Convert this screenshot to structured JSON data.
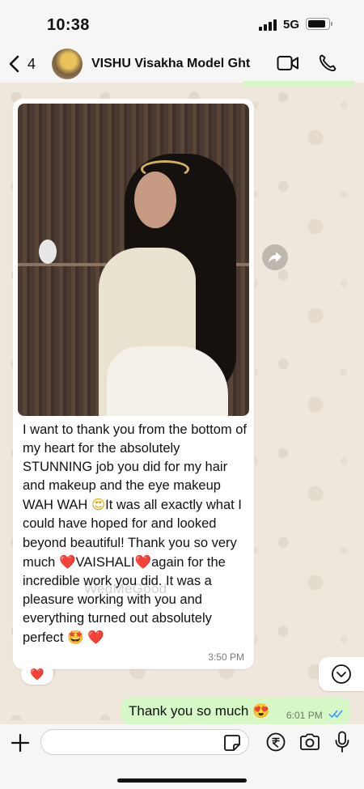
{
  "status_bar": {
    "time": "10:38",
    "network": "5G"
  },
  "header": {
    "back_count": "4",
    "contact_name": "VISHU Visakha Model Ght",
    "icons": [
      "chevron-left-icon",
      "video-call-icon",
      "phone-call-icon"
    ]
  },
  "incoming_message": {
    "text_parts": [
      "I want to thank you from the bottom of my heart for the absolutely STUNNING job you did for my hair and makeup and the eye makeup WAH WAH ",
      "😍",
      "It was all exactly what I could have hoped for and looked beyond beautiful! Thank you so very much ",
      "❤️",
      "VAISHALI",
      "❤️",
      "again for the incredible work you did. It was a pleasure working with you and everything turned out absolutely perfect ",
      "🤩",
      "❤️"
    ],
    "time": "3:50 PM",
    "watermark": "WedMeGood",
    "reaction": "❤️"
  },
  "outgoing_message": {
    "text": "Thank you so much 😍",
    "time": "6:01 PM"
  },
  "input": {
    "placeholder": ""
  },
  "colors": {
    "outgoing_bubble": "#d6f8c6",
    "incoming_bubble": "#ffffff",
    "read_ticks": "#3497f9",
    "background": "#efe7dc"
  }
}
